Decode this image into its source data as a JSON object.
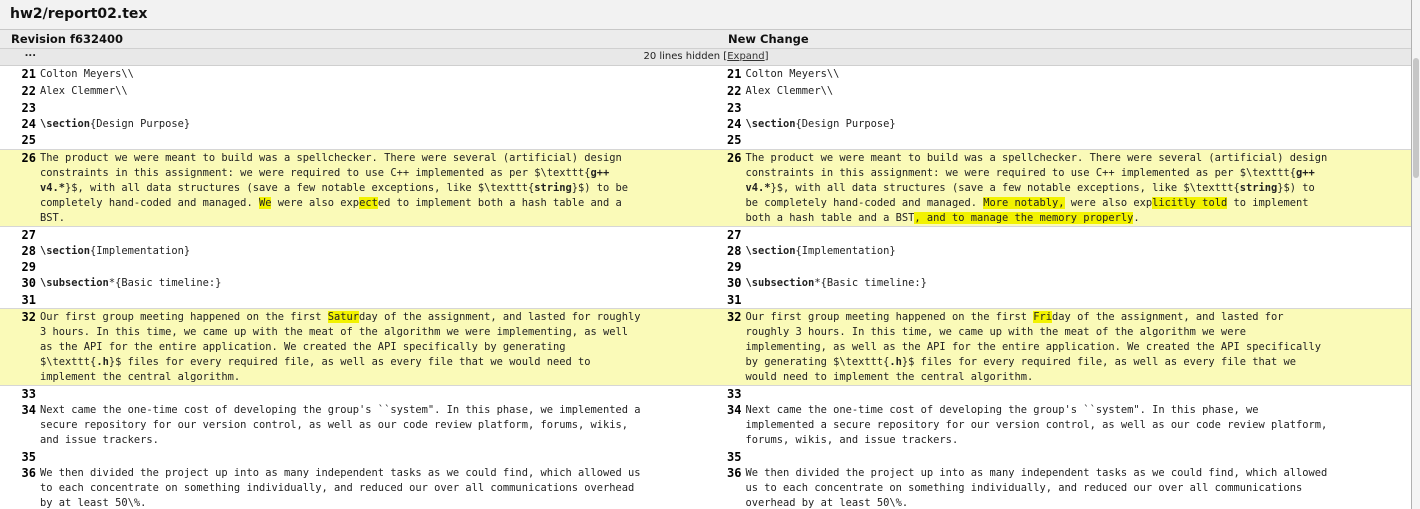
{
  "file_title": "hw2/report02.tex",
  "left_header": "Revision f632400",
  "right_header": "New Change",
  "hidden": {
    "dots": "...",
    "text": "20 lines hidden [",
    "link": "Expand",
    "close": "]"
  },
  "rows": [
    {
      "n": "21",
      "h": 17,
      "changed": false,
      "left": "Colton Meyers\\\\",
      "right": "Colton Meyers\\\\"
    },
    {
      "n": "22",
      "h": 17,
      "changed": false,
      "left": "Alex Clemmer\\\\",
      "right": "Alex Clemmer\\\\"
    },
    {
      "n": "23",
      "h": 16,
      "changed": false,
      "left": "",
      "right": ""
    },
    {
      "n": "24",
      "h": 16,
      "changed": false,
      "left": "[[\\section]]{Design Purpose}",
      "right": "[[\\section]]{Design Purpose}"
    },
    {
      "n": "25",
      "h": 17,
      "changed": false,
      "left": "",
      "right": ""
    },
    {
      "n": "26",
      "h": 78,
      "changed": true,
      "left": "The product we were meant to build was a spellchecker. There were several (artificial) design\nconstraints in this assignment: we were required to use C++ implemented as per $\\texttt{[[g++\nv4.*]]}$, with all data structures (save a few notable exceptions, like $\\texttt{[[string]]}$) to be\ncompletely hand-coded and managed. ==We== were also exp==ect==ed to implement both a hash table and a\nBST.",
      "right": "The product we were meant to build was a spellchecker. There were several (artificial) design\nconstraints in this assignment: we were required to use C++ implemented as per $\\texttt{[[g++\nv4.*]]}$, with all data structures (save a few notable exceptions, like $\\texttt{[[string]]}$) to\nbe completely hand-coded and managed. ==More notably,== were also exp==licitly told== to implement\nboth a hash table and a BST==, and to manage the memory properly==."
    },
    {
      "n": "27",
      "h": 16,
      "changed": false,
      "left": "",
      "right": ""
    },
    {
      "n": "28",
      "h": 16,
      "changed": false,
      "left": "[[\\section]]{Implementation}",
      "right": "[[\\section]]{Implementation}"
    },
    {
      "n": "29",
      "h": 16,
      "changed": false,
      "left": "",
      "right": ""
    },
    {
      "n": "30",
      "h": 17,
      "changed": false,
      "left": "[[\\subsection]]*{Basic timeline:}",
      "right": "[[\\subsection]]*{Basic timeline:}"
    },
    {
      "n": "31",
      "h": 16,
      "changed": false,
      "left": "",
      "right": ""
    },
    {
      "n": "32",
      "h": 78,
      "changed": true,
      "left": "Our first group meeting happened on the first ==Satur==day of the assignment, and lasted for roughly\n3 hours. In this time, we came up with the meat of the algorithm we were implementing, as well\nas the API for the entire application. We created the API specifically by generating\n$\\texttt{[[.h]]}$ files for every required file, as well as every file that we would need to\nimplement the central algorithm.",
      "right": "Our first group meeting happened on the first ==Fri==day of the assignment, and lasted for\nroughly 3 hours. In this time, we came up with the meat of the algorithm we were\nimplementing, as well as the API for the entire application. We created the API specifically\nby generating $\\texttt{[[.h]]}$ files for every required file, as well as every file that we\nwould need to implement the central algorithm."
    },
    {
      "n": "33",
      "h": 16,
      "changed": false,
      "left": "",
      "right": ""
    },
    {
      "n": "34",
      "h": 47,
      "changed": false,
      "left": "Next came the one-time cost of developing the group's ``system\". In this phase, we implemented a\nsecure repository for our version control, as well as our code review platform, forums, wikis,\nand issue trackers.",
      "right": "Next came the one-time cost of developing the group's ``system\". In this phase, we\nimplemented a secure repository for our version control, as well as our code review platform,\nforums, wikis, and issue trackers."
    },
    {
      "n": "35",
      "h": 16,
      "changed": false,
      "left": "",
      "right": ""
    },
    {
      "n": "36",
      "h": 47,
      "changed": false,
      "left": "We then divided the project up into as many independent tasks as we could find, which allowed us\nto each concentrate on something individually, and reduced our over all communications overhead\nby at least 50\\%.",
      "right": "We then divided the project up into as many independent tasks as we could find, which allowed\nus to each concentrate on something individually, and reduced our over all communications\noverhead by at least 50\\%."
    }
  ]
}
